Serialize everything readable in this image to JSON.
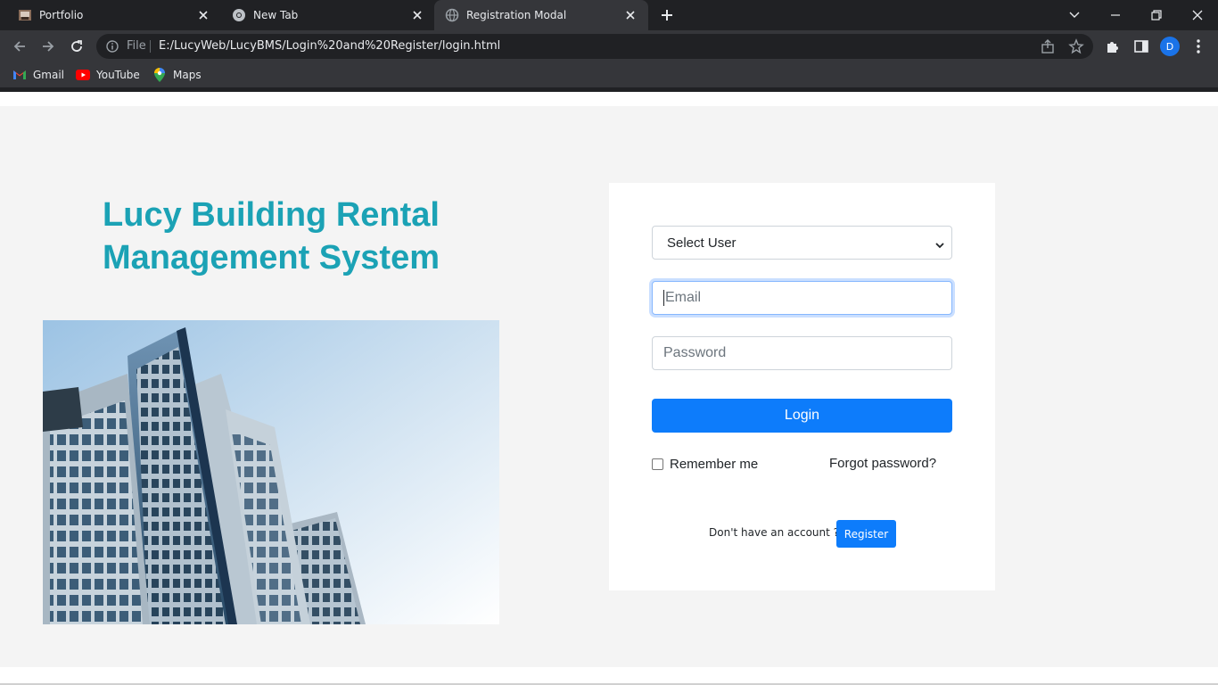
{
  "browser": {
    "tabs": [
      {
        "title": "Portfolio",
        "icon": "portfolio-favicon"
      },
      {
        "title": "New Tab",
        "icon": "chrome-icon"
      },
      {
        "title": "Registration Modal",
        "icon": "globe-icon",
        "active": true
      }
    ],
    "address": {
      "scheme_label": "File",
      "url": "E:/LucyWeb/LucyBMS/Login%20and%20Register/login.html"
    },
    "profile_initial": "D",
    "bookmarks": [
      {
        "label": "Gmail",
        "icon": "gmail-icon"
      },
      {
        "label": "YouTube",
        "icon": "youtube-icon"
      },
      {
        "label": "Maps",
        "icon": "maps-icon"
      }
    ]
  },
  "page": {
    "title_line1": "Lucy Building Rental",
    "title_line2": "Management System",
    "hero_image": "building-photo",
    "form": {
      "select_value": "Select User",
      "email_placeholder": "Email",
      "password_placeholder": "Password",
      "login_label": "Login",
      "remember_label": "Remember me",
      "forgot_label": "Forgot password?",
      "no_account_text": "Don't have an account ?",
      "register_label": "Register"
    }
  },
  "colors": {
    "title": "#1ba2b5",
    "primary_button": "#0d7cfb",
    "page_bg": "#f4f4f4",
    "card_bg": "#ffffff"
  }
}
